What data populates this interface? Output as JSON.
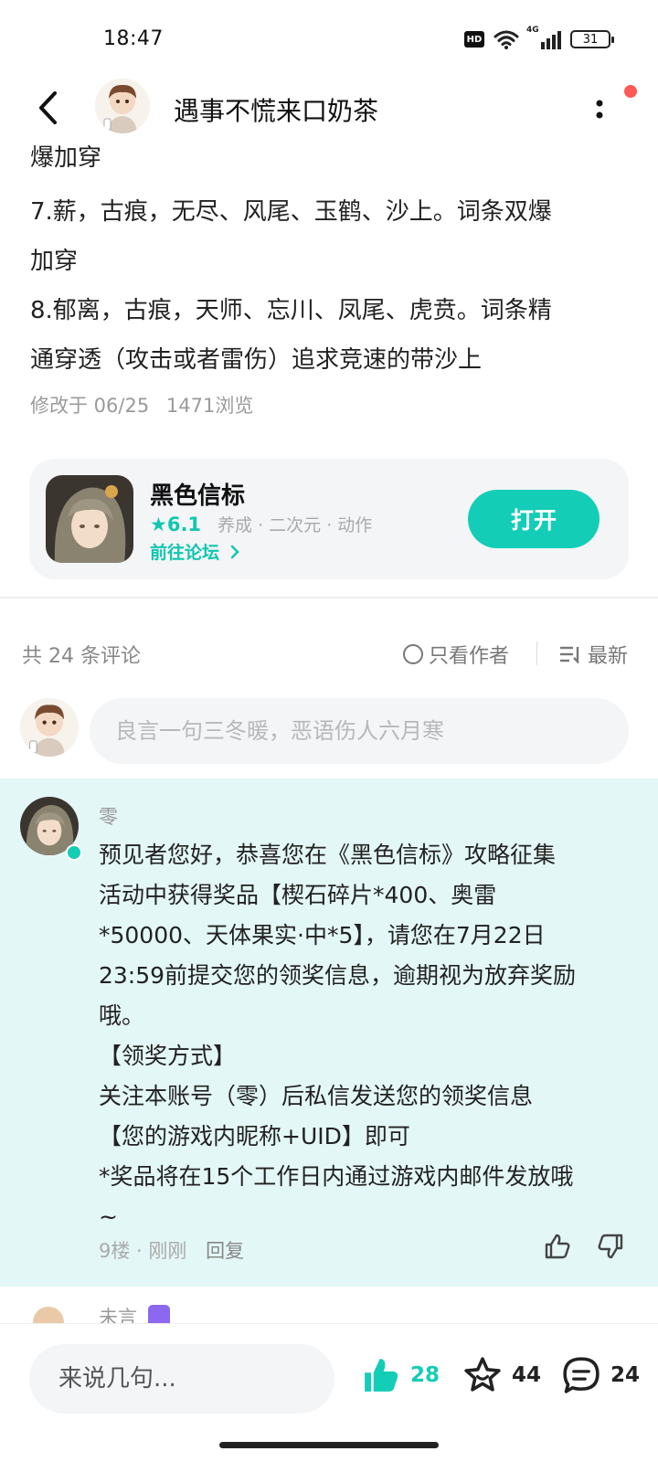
{
  "status_bar": {
    "time": "18:47",
    "hd": "HD",
    "network": "4G",
    "battery": "31"
  },
  "header": {
    "title": "遇事不慌来口奶茶"
  },
  "article": {
    "cut_line": "爆加穿",
    "lines": [
      "7.薪，古痕，无尽、风尾、玉鹤、沙上。词条双爆",
      "加穿",
      "8.郁离，古痕，天师、忘川、凤尾、虎贲。词条精",
      "通穿透（攻击或者雷伤）追求竞速的带沙上"
    ],
    "meta_modified": "修改于 06/25",
    "meta_views": "1471浏览"
  },
  "game_card": {
    "name": "黑色信标",
    "rating": "★6.1",
    "tags": "养成 · 二次元 · 动作",
    "forum_link": "前往论坛",
    "open_label": "打开"
  },
  "comments": {
    "count_label": "共 24 条评论",
    "author_only": "只看作者",
    "sort_label": "最新",
    "input_placeholder": "良言一句三冬暖，恶语伤人六月寒"
  },
  "highlight_comment": {
    "name": "零",
    "text": "预见者您好，恭喜您在《黑色信标》攻略征集\n活动中获得奖品【楔石碎片*400、奥雷\n*50000、天体果实·中*5】，请您在7月22日\n23:59前提交您的领奖信息，逾期视为放弃奖励\n哦。\n【领奖方式】\n关注本账号（零）后私信发送您的领奖信息\n【您的游戏内昵称+UID】即可\n*奖品将在15个工作日内通过游戏内邮件发放哦\n~",
    "floor_time": "9楼 · 刚刚",
    "reply": "回复"
  },
  "next_comment": {
    "name": "未言"
  },
  "bottom_bar": {
    "input_placeholder": "来说几句...",
    "likes": "28",
    "favorites": "44",
    "comments": "24"
  },
  "colors": {
    "accent": "#14cdb6",
    "highlight_bg": "#e3f7f6",
    "notification": "#ff5a55"
  }
}
